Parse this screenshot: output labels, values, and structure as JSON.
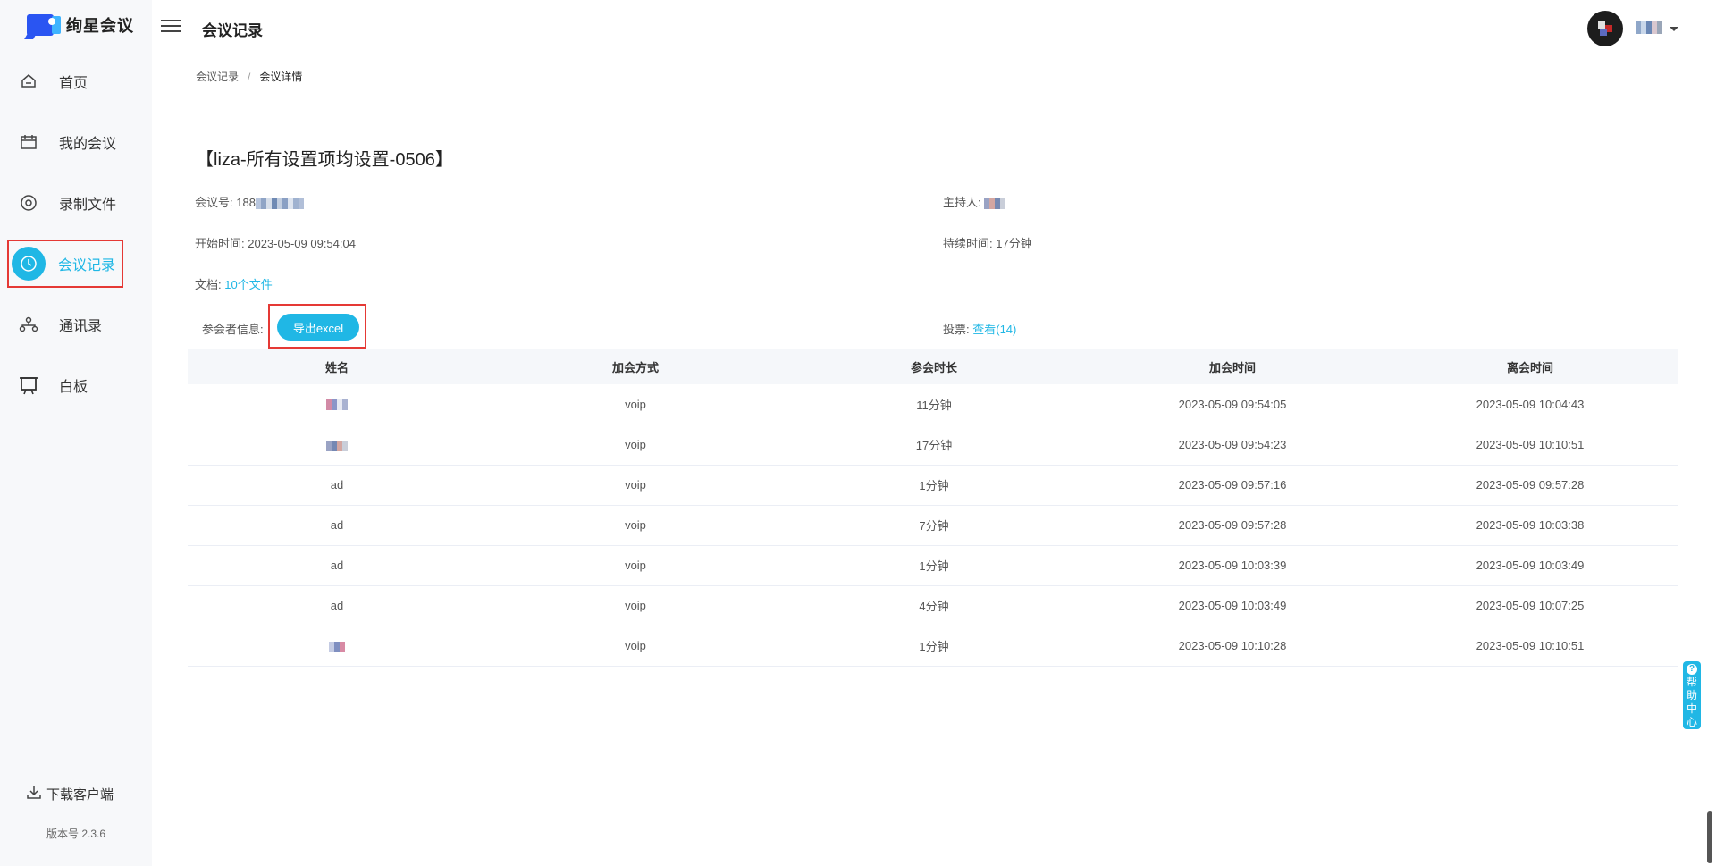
{
  "app": {
    "name": "绚星会议"
  },
  "sidebar": {
    "items": [
      {
        "label": "首页",
        "icon": "home-icon"
      },
      {
        "label": "我的会议",
        "icon": "calendar-icon"
      },
      {
        "label": "录制文件",
        "icon": "record-icon"
      },
      {
        "label": "会议记录",
        "icon": "clock-icon",
        "active": true
      },
      {
        "label": "通讯录",
        "icon": "contacts-icon"
      },
      {
        "label": "白板",
        "icon": "whiteboard-icon"
      }
    ],
    "download_label": "下载客户端",
    "version": "版本号 2.3.6"
  },
  "header": {
    "title": "会议记录"
  },
  "breadcrumb": {
    "parent": "会议记录",
    "separator": "/",
    "current": "会议详情"
  },
  "meeting": {
    "title": "【liza-所有设置项均设置-0506】",
    "id_label": "会议号:",
    "id_value": "188",
    "host_label": "主持人:",
    "start_label": "开始时间:",
    "start_value": "2023-05-09 09:54:04",
    "duration_label": "持续时间:",
    "duration_value": "17分钟",
    "docs_label": "文档:",
    "docs_value": "10个文件",
    "participants_label": "参会者信息:",
    "export_label": "导出excel",
    "vote_label": "投票:",
    "vote_value": "查看(14)"
  },
  "table": {
    "headers": [
      "姓名",
      "加会方式",
      "参会时长",
      "加会时间",
      "离会时间"
    ],
    "rows": [
      {
        "name": "",
        "method": "voip",
        "duration": "11分钟",
        "join": "2023-05-09 09:54:05",
        "leave": "2023-05-09 10:04:43"
      },
      {
        "name": "",
        "method": "voip",
        "duration": "17分钟",
        "join": "2023-05-09 09:54:23",
        "leave": "2023-05-09 10:10:51"
      },
      {
        "name": "ad",
        "method": "voip",
        "duration": "1分钟",
        "join": "2023-05-09 09:57:16",
        "leave": "2023-05-09 09:57:28"
      },
      {
        "name": "ad",
        "method": "voip",
        "duration": "7分钟",
        "join": "2023-05-09 09:57:28",
        "leave": "2023-05-09 10:03:38"
      },
      {
        "name": "ad",
        "method": "voip",
        "duration": "1分钟",
        "join": "2023-05-09 10:03:39",
        "leave": "2023-05-09 10:03:49"
      },
      {
        "name": "ad",
        "method": "voip",
        "duration": "4分钟",
        "join": "2023-05-09 10:03:49",
        "leave": "2023-05-09 10:07:25"
      },
      {
        "name": "",
        "method": "voip",
        "duration": "1分钟",
        "join": "2023-05-09 10:10:28",
        "leave": "2023-05-09 10:10:51"
      }
    ]
  },
  "help": {
    "label": "帮助中心"
  },
  "colors": {
    "accent": "#20b7e5",
    "highlight": "#e53935"
  }
}
